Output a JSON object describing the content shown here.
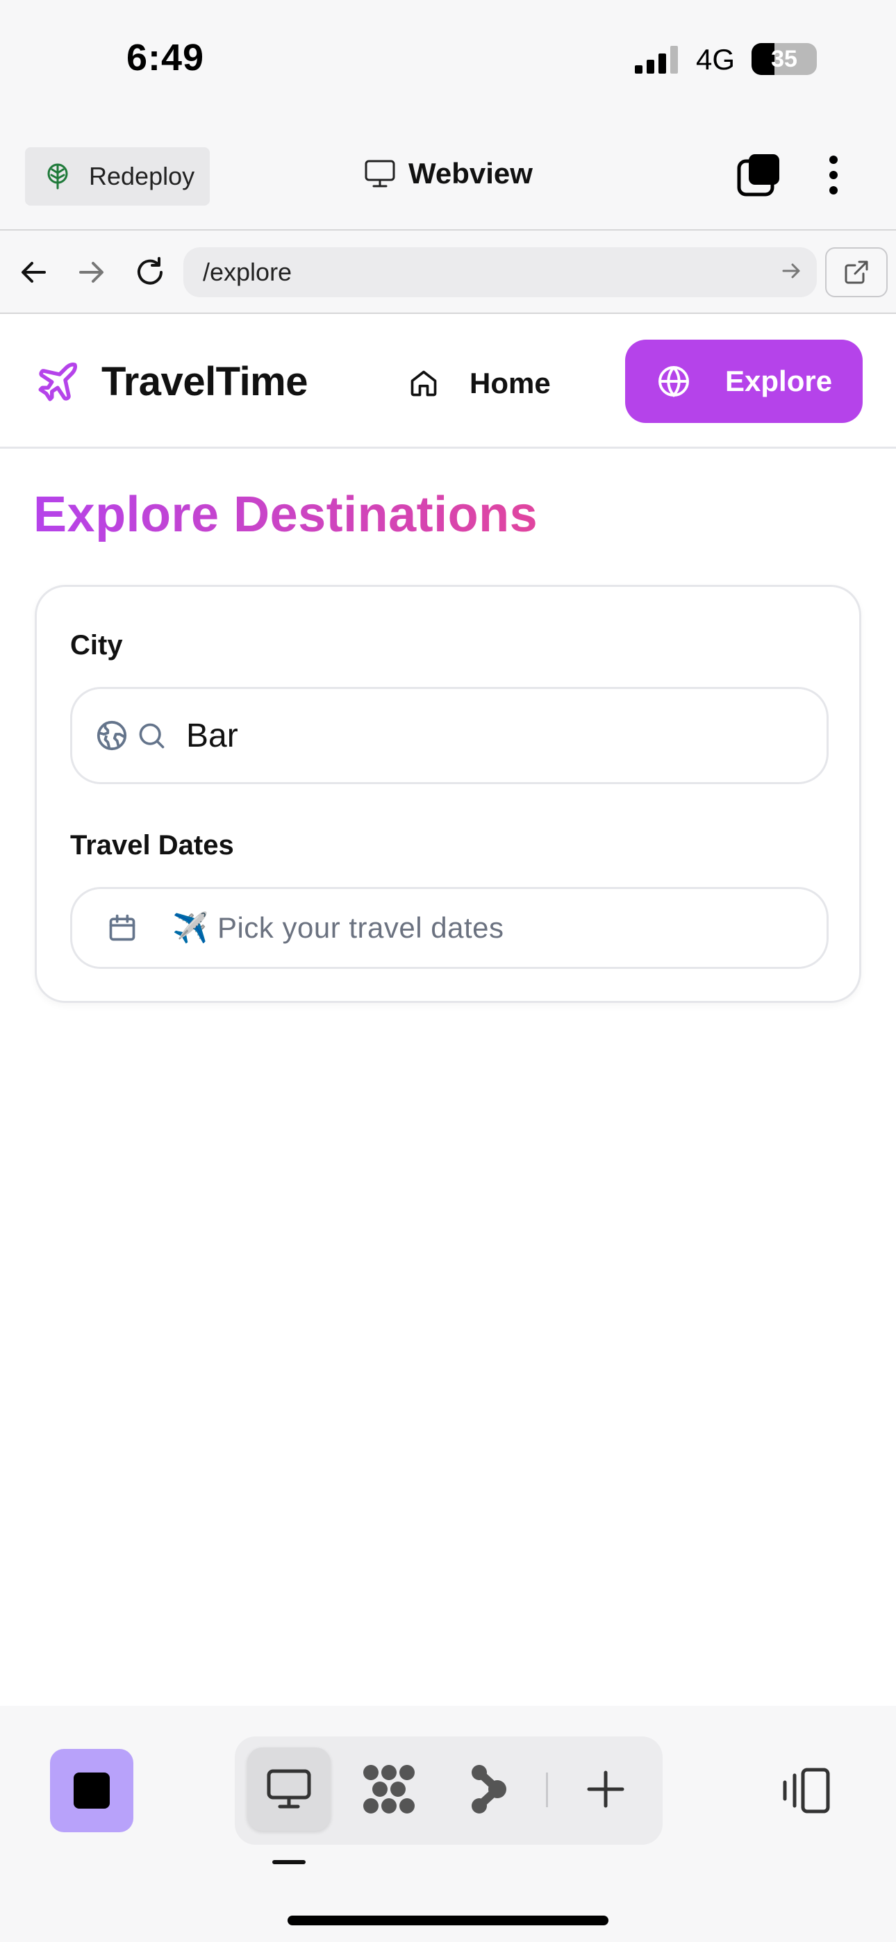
{
  "status_bar": {
    "time": "6:49",
    "network": "4G",
    "battery_level": "35",
    "battery_fraction": 0.35
  },
  "toolbar": {
    "redeploy_label": "Redeploy",
    "webview_title": "Webview"
  },
  "browser": {
    "url": "/explore"
  },
  "site": {
    "brand_name": "TravelTime",
    "nav": {
      "home_label": "Home",
      "explore_label": "Explore"
    },
    "page_title": "Explore Destinations",
    "search": {
      "city_label": "City",
      "city_value": "Bar",
      "dates_label": "Travel Dates",
      "dates_placeholder": "✈️ Pick your travel dates"
    }
  },
  "colors": {
    "accent": "#b543ea",
    "title_gradient_end": "#e0459f",
    "stop_button": "#b8a2fa"
  },
  "icons": {
    "redeploy": "tree-icon",
    "webview": "monitor-icon",
    "brand": "plane-icon",
    "home": "house-icon",
    "explore": "globe-icon",
    "city": [
      "earth-icon",
      "search-icon"
    ],
    "dates": "calendar-icon"
  }
}
